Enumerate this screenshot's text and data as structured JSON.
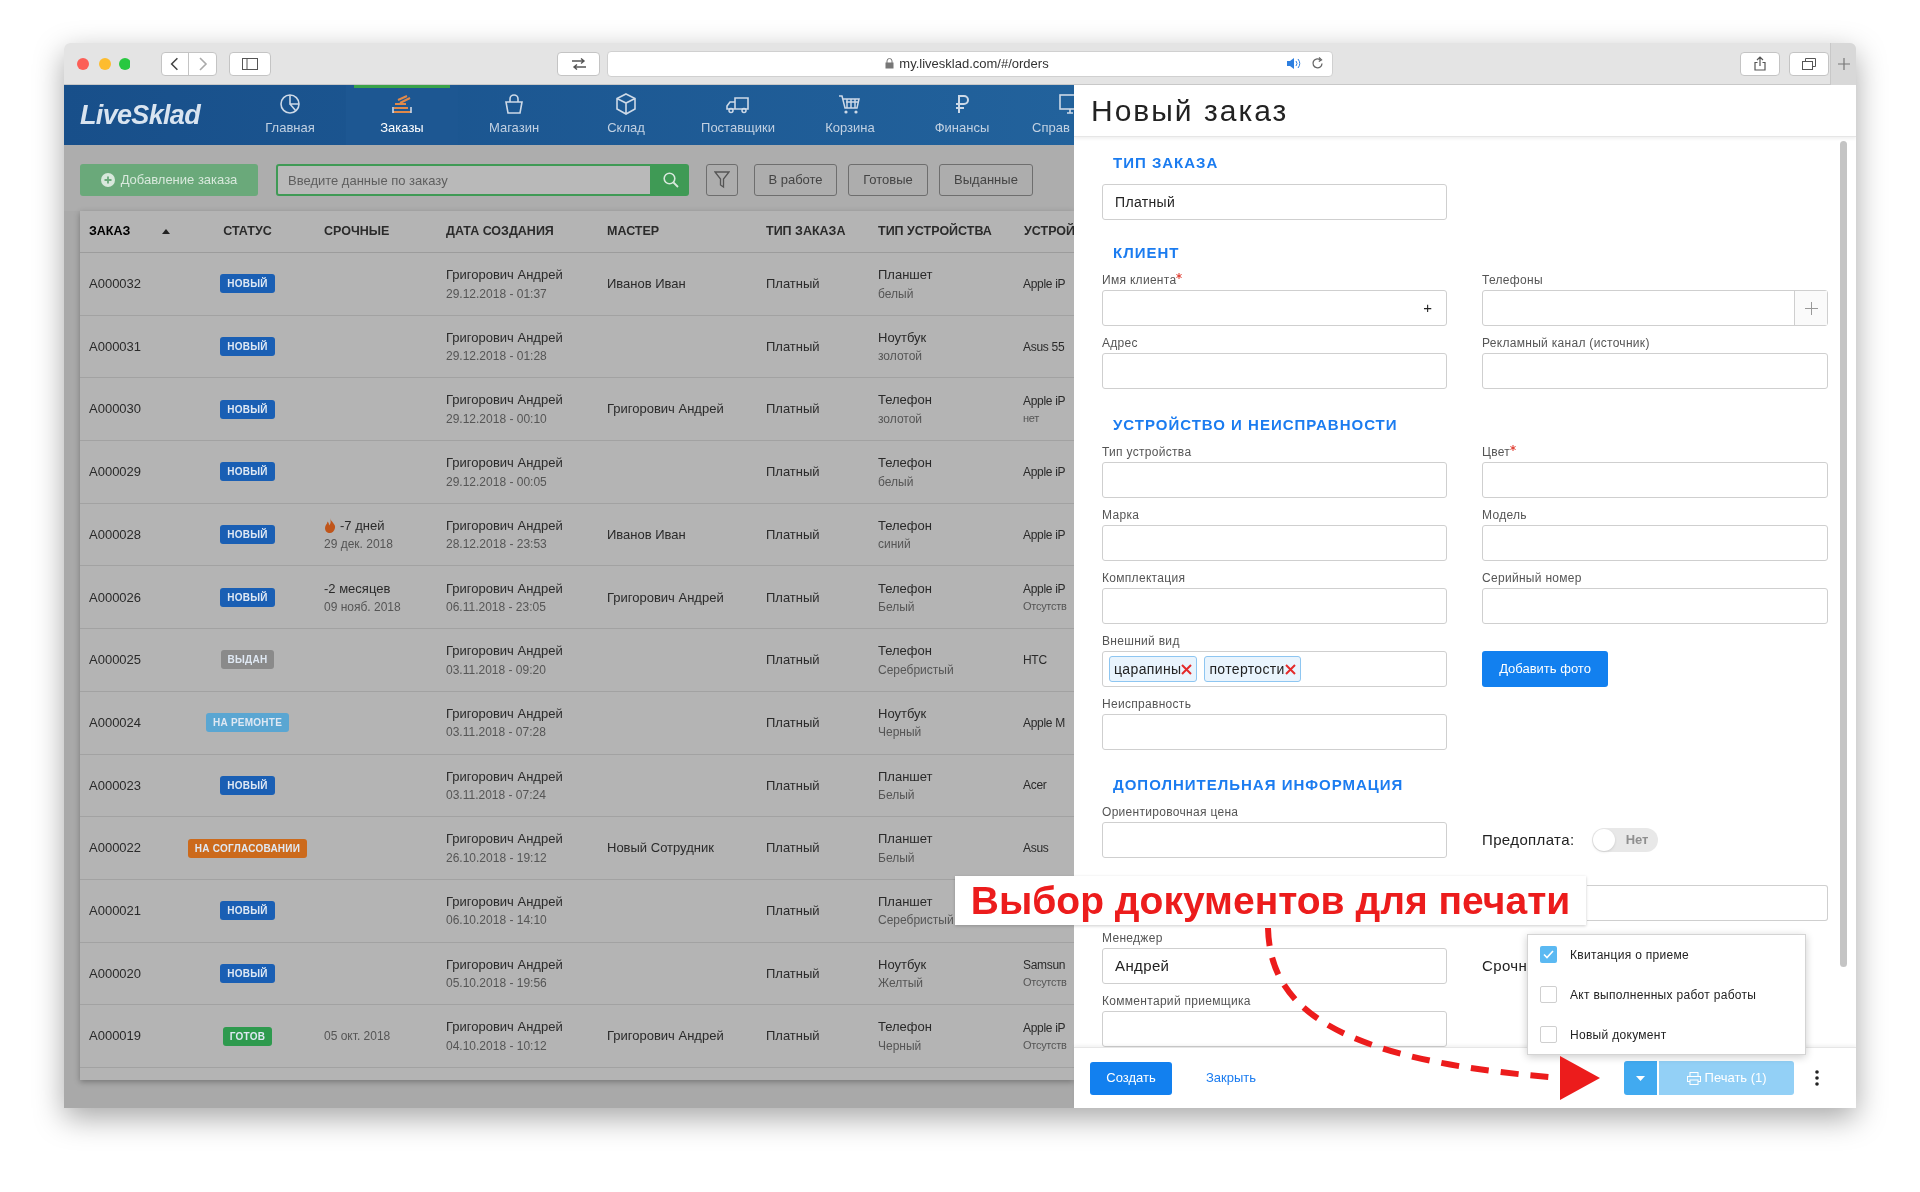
{
  "browser": {
    "url": "my.livesklad.com/#/orders"
  },
  "app": {
    "logo": "LiveSklad",
    "nav": [
      {
        "label": "Главная",
        "selected": false
      },
      {
        "label": "Заказы",
        "selected": true
      },
      {
        "label": "Магазин",
        "selected": false
      },
      {
        "label": "Склад",
        "selected": false
      },
      {
        "label": "Поставщики",
        "selected": false
      },
      {
        "label": "Корзина",
        "selected": false
      },
      {
        "label": "Финансы",
        "selected": false
      },
      {
        "label": "Справ",
        "selected": false
      }
    ]
  },
  "toolbar": {
    "add_button": "Добавление заказа",
    "search_placeholder": "Введите данные по заказу",
    "filters": [
      "В работе",
      "Готовые",
      "Выданные"
    ]
  },
  "table": {
    "columns": [
      {
        "label": "ЗАКАЗ",
        "sorted": true
      },
      {
        "label": "СТАТУС",
        "sorted": false
      },
      {
        "label": "СРОЧНЫЕ",
        "sorted": false
      },
      {
        "label": "ДАТА СОЗДАНИЯ",
        "sorted": false
      },
      {
        "label": "МАСТЕР",
        "sorted": false
      },
      {
        "label": "ТИП ЗАКАЗА",
        "sorted": false
      },
      {
        "label": "ТИП УСТРОЙСТВА",
        "sorted": false
      },
      {
        "label": "УСТРОЙ",
        "sorted": false
      }
    ],
    "rows": [
      {
        "order": "A000032",
        "status": {
          "label": "НОВЫЙ",
          "color": "#1a5fb4"
        },
        "author": "Григорович Андрей",
        "created": "29.12.2018 - 01:37",
        "master": "Иванов Иван",
        "type": "Платный",
        "device_type": "Планшет",
        "device_color": "белый",
        "device": "Apple iP"
      },
      {
        "order": "A000031",
        "status": {
          "label": "НОВЫЙ",
          "color": "#1a5fb4"
        },
        "author": "Григорович Андрей",
        "created": "29.12.2018 - 01:28",
        "type": "Платный",
        "device_type": "Ноутбук",
        "device_color": "золотой",
        "device": "Asus 55"
      },
      {
        "order": "A000030",
        "status": {
          "label": "НОВЫЙ",
          "color": "#1a5fb4"
        },
        "author": "Григорович Андрей",
        "created": "29.12.2018 - 00:10",
        "master": "Григорович Андрей",
        "type": "Платный",
        "device_type": "Телефон",
        "device_color": "золотой",
        "device": "Apple iP",
        "device_note": "нет"
      },
      {
        "order": "A000029",
        "status": {
          "label": "НОВЫЙ",
          "color": "#1a5fb4"
        },
        "author": "Григорович Андрей",
        "created": "29.12.2018 - 00:05",
        "type": "Платный",
        "device_type": "Телефон",
        "device_color": "белый",
        "device": "Apple iP"
      },
      {
        "order": "A000028",
        "status": {
          "label": "НОВЫЙ",
          "color": "#1a5fb4"
        },
        "urgent": {
          "flame": true,
          "text": "-7 дней",
          "date": "29 дек. 2018"
        },
        "author": "Григорович Андрей",
        "created": "28.12.2018 - 23:53",
        "master": "Иванов Иван",
        "type": "Платный",
        "device_type": "Телефон",
        "device_color": "синий",
        "device": "Apple iP"
      },
      {
        "order": "A000026",
        "status": {
          "label": "НОВЫЙ",
          "color": "#1a5fb4"
        },
        "urgent": {
          "flame": false,
          "text": "-2 месяцев",
          "date": "09 нояб. 2018"
        },
        "author": "Григорович Андрей",
        "created": "06.11.2018 - 23:05",
        "master": "Григорович Андрей",
        "type": "Платный",
        "device_type": "Телефон",
        "device_color": "Белый",
        "device": "Apple iP",
        "device_note": "Отсутств"
      },
      {
        "order": "A000025",
        "status": {
          "label": "ВЫДАН",
          "color": "#8a8a8a"
        },
        "author": "Григорович Андрей",
        "created": "03.11.2018 - 09:20",
        "type": "Платный",
        "device_type": "Телефон",
        "device_color": "Серебристый",
        "device": "HTC"
      },
      {
        "order": "A000024",
        "status": {
          "label": "НА РЕМОНТЕ",
          "color": "#5aa6d2"
        },
        "author": "Григорович Андрей",
        "created": "03.11.2018 - 07:28",
        "type": "Платный",
        "device_type": "Ноутбук",
        "device_color": "Черный",
        "device": "Apple M"
      },
      {
        "order": "A000023",
        "status": {
          "label": "НОВЫЙ",
          "color": "#1a5fb4"
        },
        "author": "Григорович Андрей",
        "created": "03.11.2018 - 07:24",
        "type": "Платный",
        "device_type": "Планшет",
        "device_color": "Белый",
        "device": "Acer"
      },
      {
        "order": "A000022",
        "status": {
          "label": "НА СОГЛАСОВАНИИ",
          "color": "#cc6a1c"
        },
        "author": "Григорович Андрей",
        "created": "26.10.2018 - 19:12",
        "master": "Новый Сотрудник",
        "type": "Платный",
        "device_type": "Планшет",
        "device_color": "Белый",
        "device": "Asus"
      },
      {
        "order": "A000021",
        "status": {
          "label": "НОВЫЙ",
          "color": "#1a5fb4"
        },
        "author": "Григорович Андрей",
        "created": "06.10.2018 - 14:10",
        "type": "Платный",
        "device_type": "Планшет",
        "device_color": "Серебристый"
      },
      {
        "order": "A000020",
        "status": {
          "label": "НОВЫЙ",
          "color": "#1a5fb4"
        },
        "author": "Григорович Андрей",
        "created": "05.10.2018 - 19:56",
        "type": "Платный",
        "device_type": "Ноутбук",
        "device_color": "Желтый",
        "device": "Samsun",
        "device_note": "Отсутств"
      },
      {
        "order": "A000019",
        "status": {
          "label": "ГОТОВ",
          "color": "#2e9a4e"
        },
        "urgent": {
          "flame": false,
          "date": "05 окт. 2018"
        },
        "author": "Григорович Андрей",
        "created": "04.10.2018 - 10:12",
        "master": "Григорович Андрей",
        "type": "Платный",
        "device_type": "Телефон",
        "device_color": "Черный",
        "device": "Apple iP",
        "device_note": "Отсутств"
      }
    ]
  },
  "panel": {
    "title": "Новый заказ",
    "sections": [
      {
        "heading": "ТИП ЗАКАЗА",
        "fields": [
          {
            "kind": "select",
            "value": "Платный"
          }
        ]
      },
      {
        "heading": "КЛИЕНТ",
        "fields": [
          {
            "kind": "input",
            "label": "Имя клиента",
            "required": true,
            "suffix": "+"
          },
          {
            "kind": "input",
            "label": "Телефоны",
            "add_button": true
          },
          {
            "kind": "input",
            "label": "Адрес"
          },
          {
            "kind": "input",
            "label": "Рекламный канал (источник)"
          }
        ]
      },
      {
        "heading": "УСТРОЙСТВО И НЕИСПРАВНОСТИ",
        "fields": [
          {
            "kind": "input",
            "label": "Тип устройства"
          },
          {
            "kind": "input",
            "label": "Цвет",
            "required": true
          },
          {
            "kind": "input",
            "label": "Марка"
          },
          {
            "kind": "input",
            "label": "Модель"
          },
          {
            "kind": "input",
            "label": "Комплектация"
          },
          {
            "kind": "input",
            "label": "Серийный номер"
          },
          {
            "kind": "tags",
            "label": "Внешний вид",
            "tags": [
              "царапины",
              "потертости"
            ]
          },
          {
            "kind": "button",
            "text": "Добавить фото"
          },
          {
            "kind": "input",
            "label": "Неисправность"
          },
          {
            "kind": "empty"
          }
        ]
      },
      {
        "heading": "ДОПОЛНИТЕЛЬНАЯ ИНФОРМАЦИЯ",
        "fields": [
          {
            "kind": "input",
            "label": "Ориентировочная цена"
          },
          {
            "kind": "toggle",
            "label": "Предоплата:",
            "on": false,
            "text": "Нет"
          },
          {
            "kind": "empty"
          },
          {
            "kind": "input"
          },
          {
            "kind": "input",
            "label": "Менеджер",
            "value": "Андрей"
          },
          {
            "kind": "inline_label",
            "text": "Срочн"
          },
          {
            "kind": "input",
            "label": "Комментарий приемщика"
          },
          {
            "kind": "empty"
          }
        ]
      }
    ],
    "footer": {
      "create": "Создать",
      "close": "Закрыть",
      "print": "Печать (1)"
    },
    "print_menu": [
      {
        "label": "Квитанция о приеме",
        "checked": true
      },
      {
        "label": "Акт выполненных работ работы",
        "checked": false
      },
      {
        "label": "Новый документ",
        "checked": false
      }
    ]
  },
  "annotation": {
    "text": "Выбор документов для печати"
  }
}
